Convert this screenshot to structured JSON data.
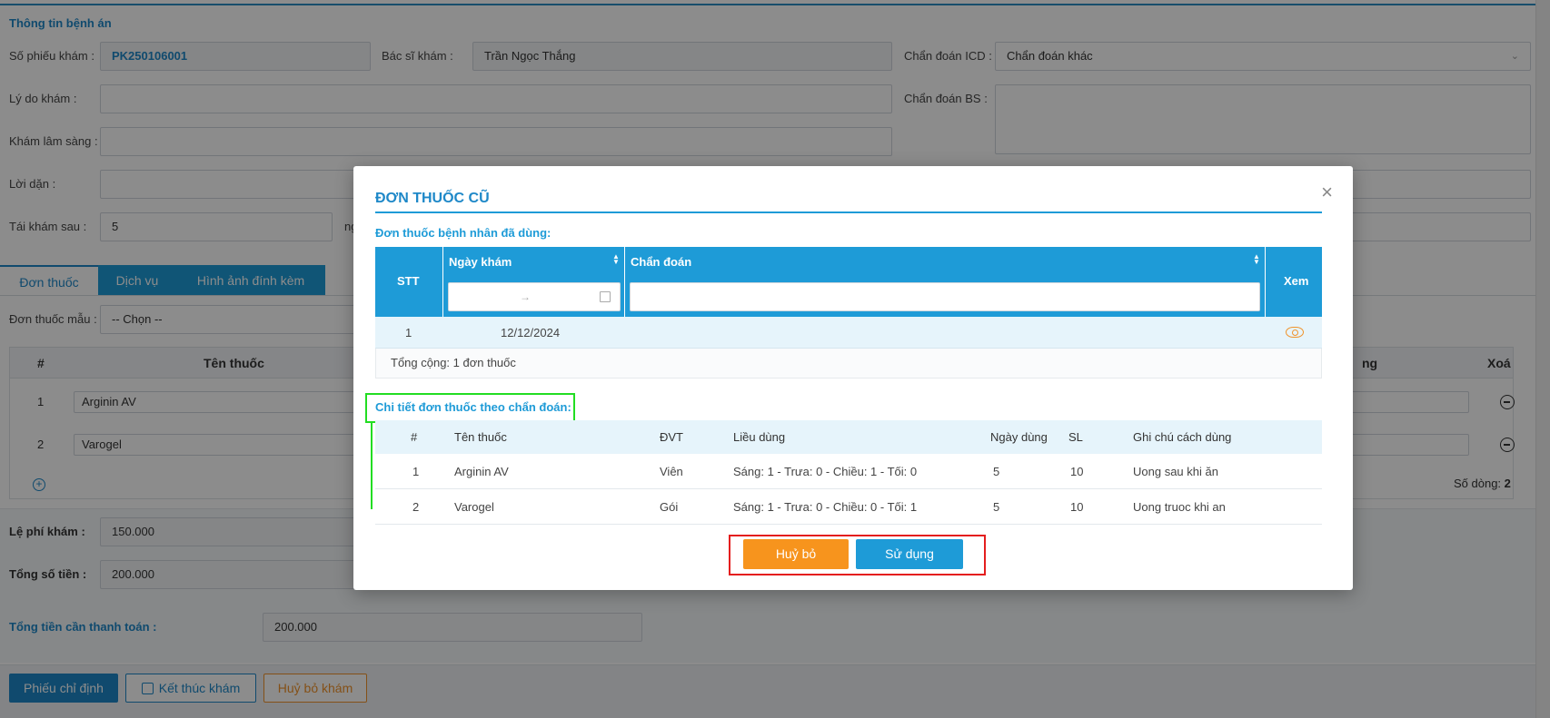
{
  "form": {
    "section_title": "Thông tin bệnh án",
    "ticket_label": "Số phiếu khám",
    "ticket_value": "PK250106001",
    "doctor_label": "Bác sĩ khám",
    "doctor_value": "Trần Ngọc Thắng",
    "icd_label": "Chẩn đoán ICD",
    "icd_value": "Chẩn đoán khác",
    "reason_label": "Lý do khám",
    "doctor_diag_label": "Chẩn đoán BS",
    "clinical_label": "Khám lâm sàng",
    "advice_label": "Lời dặn",
    "revisit_label": "Tái khám sau",
    "revisit_value": "5",
    "revisit_unit": "ng"
  },
  "tabs": [
    "Đơn thuốc",
    "Dịch vụ",
    "Hình ảnh đính kèm"
  ],
  "prescription": {
    "template_label": "Đơn thuốc mẫu",
    "template_value": "-- Chọn --",
    "col_index": "#",
    "col_name": "Tên thuốc",
    "col_usage_partial": "ng",
    "col_delete": "Xoá",
    "rows": [
      {
        "index": "1",
        "name": "Arginin AV"
      },
      {
        "index": "2",
        "name": "Varogel"
      }
    ],
    "row_count_label": "Số dòng:",
    "row_count": "2"
  },
  "fees": {
    "exam_fee_label": "Lệ phí khám",
    "exam_fee_value": "150.000",
    "total_label": "Tổng số tiền",
    "total_value": "200.000",
    "pay_label": "Tổng tiền cần thanh toán",
    "pay_value": "200.000"
  },
  "footer": {
    "order_button": "Phiếu chỉ định",
    "finish_button": "Kết thúc khám",
    "cancel_button": "Huỷ bỏ khám"
  },
  "modal": {
    "title": "ĐƠN THUỐC CŨ",
    "close_glyph": "×",
    "history_title": "Đơn thuốc bệnh nhân đã dùng:",
    "history_columns": {
      "index": "STT",
      "date": "Ngày khám",
      "diagnosis": "Chẩn đoán",
      "view": "Xem"
    },
    "date_range_arrow": "→",
    "history_rows": [
      {
        "index": "1",
        "date": "12/12/2024",
        "diagnosis": ""
      }
    ],
    "history_total": "Tổng cộng: 1 đơn thuốc",
    "detail_title": "Chi tiết đơn thuốc theo chẩn đoán:",
    "detail_columns": {
      "index": "#",
      "name": "Tên thuốc",
      "unit": "ĐVT",
      "dosage": "Liều dùng",
      "days": "Ngày dùng",
      "qty": "SL",
      "note": "Ghi chú cách dùng"
    },
    "detail_rows": [
      {
        "index": "1",
        "name": "Arginin AV",
        "unit": "Viên",
        "dosage": "Sáng: 1 - Trưa: 0 - Chiều: 1 - Tối: 0",
        "days": "5",
        "qty": "10",
        "note": "Uong sau khi ăn"
      },
      {
        "index": "2",
        "name": "Varogel",
        "unit": "Gói",
        "dosage": "Sáng: 1 - Trưa: 0 - Chiều: 0 - Tối: 1",
        "days": "5",
        "qty": "10",
        "note": "Uong truoc khi an"
      }
    ],
    "cancel_button": "Huỷ bỏ",
    "use_button": "Sử dụng"
  },
  "colors": {
    "brand_blue": "#1e9bd7",
    "cancel_orange": "#f7941d",
    "annotation_green": "#22dd22",
    "annotation_red": "#e41e1e"
  }
}
